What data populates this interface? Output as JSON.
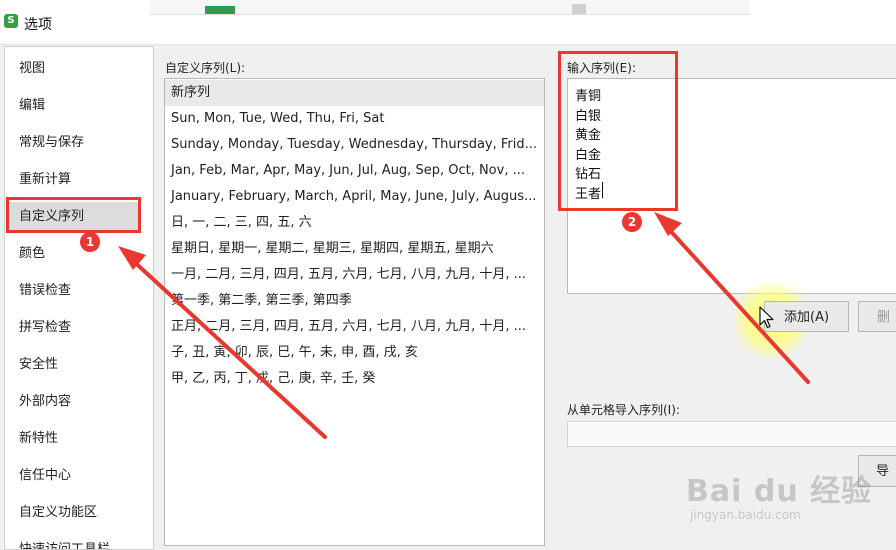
{
  "window": {
    "app_icon_letter": "S",
    "title": "选项"
  },
  "sidebar": {
    "items": [
      {
        "label": "视图"
      },
      {
        "label": "编辑"
      },
      {
        "label": "常规与保存"
      },
      {
        "label": "重新计算"
      },
      {
        "label": "自定义序列",
        "selected": true
      },
      {
        "label": "颜色"
      },
      {
        "label": "错误检查"
      },
      {
        "label": "拼写检查"
      },
      {
        "label": "安全性"
      },
      {
        "label": "外部内容"
      },
      {
        "label": "新特性"
      },
      {
        "label": "信任中心"
      },
      {
        "label": "自定义功能区"
      },
      {
        "label": "快速访问工具栏"
      }
    ]
  },
  "custom_lists": {
    "label": "自定义序列(L):",
    "items": [
      "新序列",
      "Sun, Mon, Tue, Wed, Thu, Fri, Sat",
      "Sunday, Monday, Tuesday, Wednesday, Thursday, Frid...",
      "Jan, Feb, Mar, Apr, May, Jun, Jul, Aug, Sep, Oct, Nov, ...",
      "January, February, March, April, May, June, July, Augus...",
      "日, 一, 二, 三, 四, 五, 六",
      "星期日, 星期一, 星期二, 星期三, 星期四, 星期五, 星期六",
      "一月, 二月, 三月, 四月, 五月, 六月, 七月, 八月, 九月, 十月, ...",
      "第一季, 第二季, 第三季, 第四季",
      "正月, 二月, 三月, 四月, 五月, 六月, 七月, 八月, 九月, 十月, ...",
      "子, 丑, 寅, 卯, 辰, 巳, 午, 未, 申, 酉, 戌, 亥",
      "甲, 乙, 丙, 丁, 戊, 己, 庚, 辛, 壬, 癸"
    ]
  },
  "input_sequence": {
    "label": "输入序列(E):",
    "lines": [
      "青铜",
      "白银",
      "黄金",
      "白金",
      "钻石",
      "王者"
    ]
  },
  "buttons": {
    "add": "添加(A)",
    "delete": "删",
    "import": "导入"
  },
  "import_from_cells": {
    "label": "从单元格导入序列(I):",
    "value": ""
  },
  "annotations": {
    "badge_1": "1",
    "badge_2": "2",
    "accent_color": "#e8382f"
  },
  "watermark": {
    "logo": "Bai du 经验",
    "url": "jingyan.baidu.com"
  }
}
